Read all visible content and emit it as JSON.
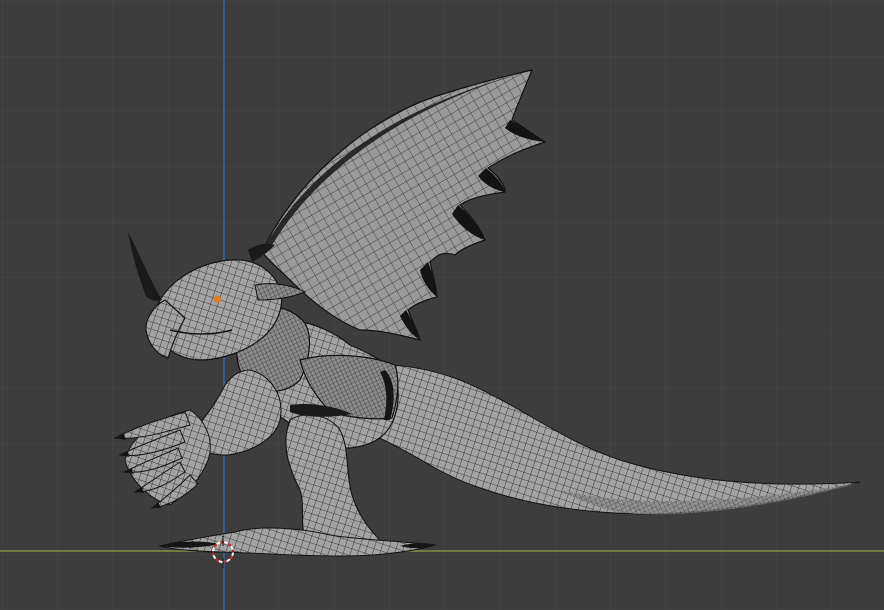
{
  "viewport": {
    "view": "blender-3d-viewport-side-orthographic",
    "background_color": "#3d3d3d",
    "grid_color": "#474747",
    "axis_x_color": "#8ca344",
    "axis_z_color": "#3f6fb0",
    "mesh_fill_color": "#8f8f8f",
    "wire_color": "#1a1a1a",
    "cursor_colors": [
      "#c92a2a",
      "#ffffff"
    ],
    "eye_color": "#e07a1a"
  },
  "object": {
    "icon": "wireframe-creature-mesh"
  }
}
